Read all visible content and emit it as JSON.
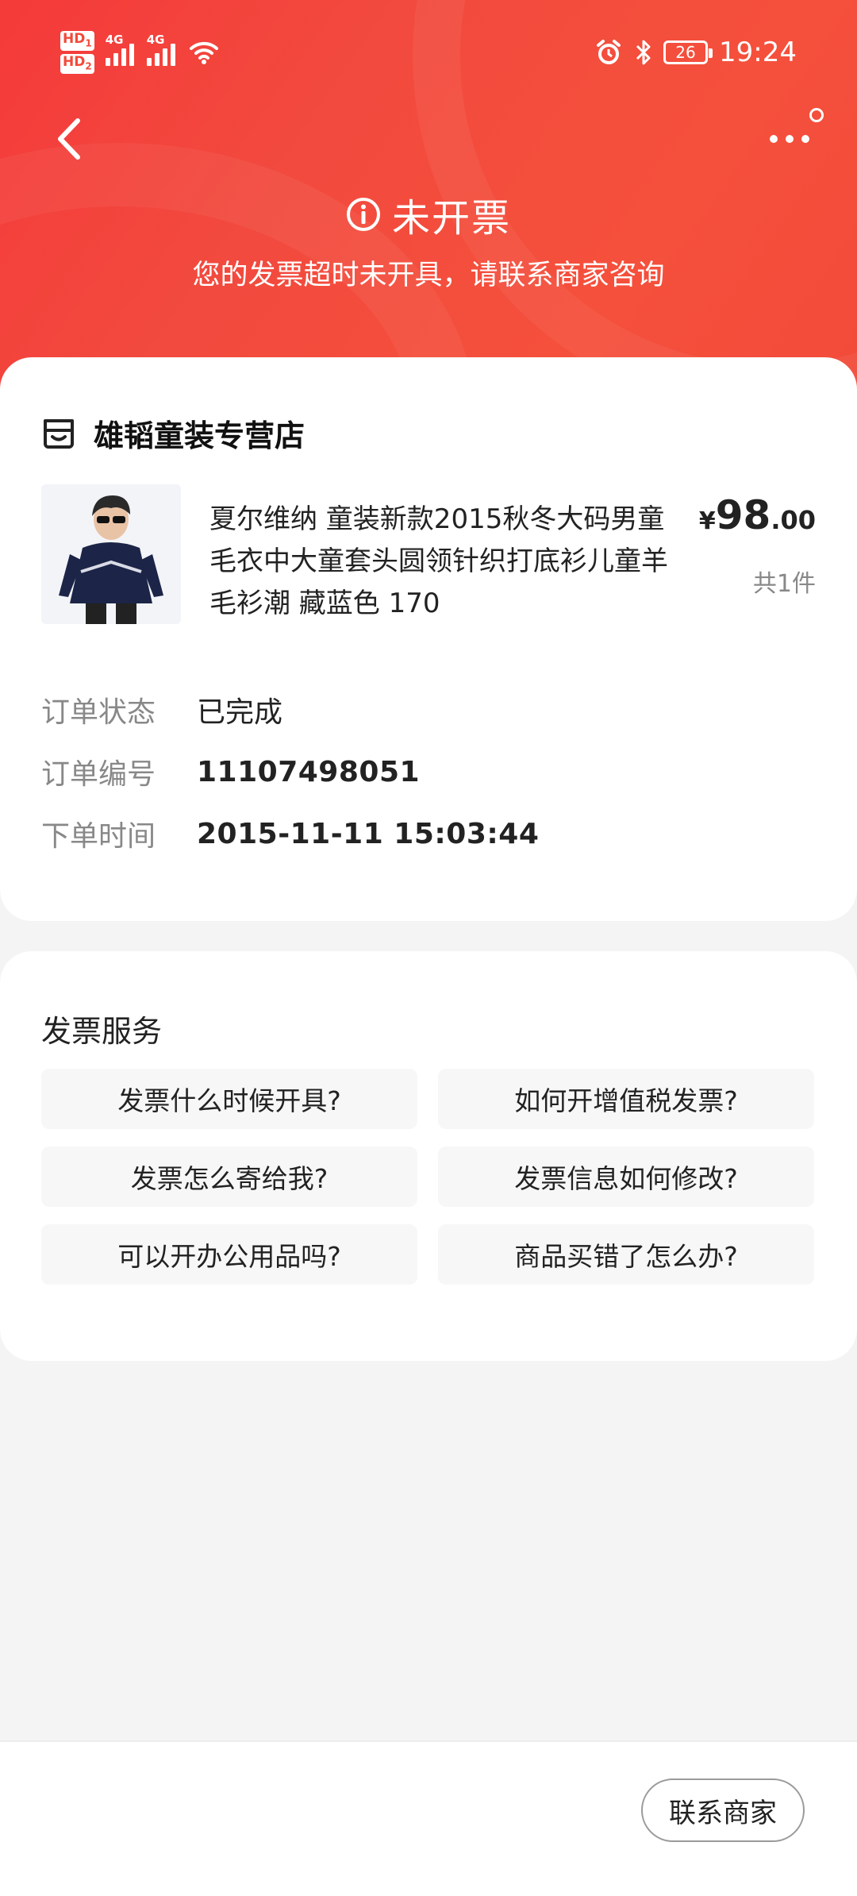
{
  "status_bar": {
    "time": "19:24",
    "battery": "26",
    "sim1_label": "HD",
    "sim1_index": "1",
    "sim2_label": "HD",
    "sim2_index": "2",
    "net1": "4G",
    "net2": "4G"
  },
  "header": {
    "status_title": "未开票",
    "status_subtitle": "您的发票超时未开具，请联系商家咨询",
    "accent_color": "#f24a3a"
  },
  "order": {
    "shop_name": "雄韬童装专营店",
    "product_title": "夏尔维纳 童装新款2015秋冬大码男童毛衣中大童套头圆领针织打底衫儿童羊毛衫潮 藏蓝色 170",
    "price_symbol": "¥",
    "price_integer": "98",
    "price_decimal": ".00",
    "quantity": "共1件",
    "rows": [
      {
        "label": "订单状态",
        "value": "已完成"
      },
      {
        "label": "订单编号",
        "value": "11107498051"
      },
      {
        "label": "下单时间",
        "value": "2015-11-11 15:03:44"
      }
    ]
  },
  "service": {
    "title": "发票服务",
    "faqs": [
      "发票什么时候开具?",
      "如何开增值税发票?",
      "发票怎么寄给我?",
      "发票信息如何修改?",
      "可以开办公用品吗?",
      "商品买错了怎么办?"
    ]
  },
  "bottom": {
    "contact_label": "联系商家"
  }
}
